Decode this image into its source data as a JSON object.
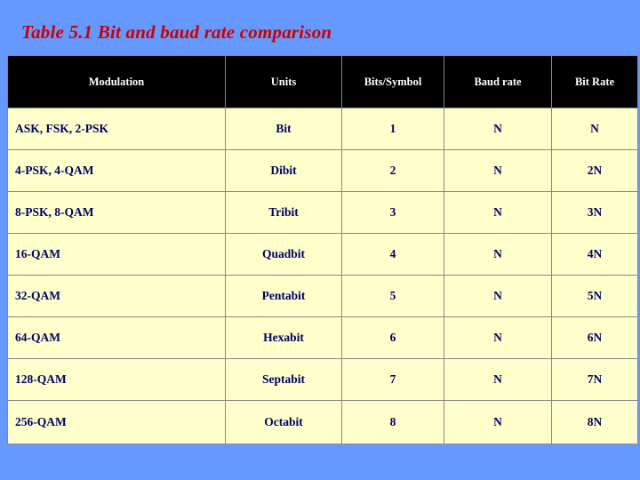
{
  "slide": {
    "title": "Table 5.1  Bit and baud rate comparison",
    "title_color": "#CC0000",
    "background_color": "#6699FF"
  },
  "table": {
    "header_background": "#000000",
    "header_text_color": "#FFFFFF",
    "cell_background": "#FFFFCC",
    "cell_text_color": "#000066",
    "columns": [
      "Modulation",
      "Units",
      "Bits/Symbol",
      "Baud rate",
      "Bit Rate"
    ],
    "rows": [
      {
        "modulation": "ASK, FSK, 2-PSK",
        "units": "Bit",
        "bits_per_symbol": "1",
        "baud_rate": "N",
        "bit_rate": "N"
      },
      {
        "modulation": "4-PSK, 4-QAM",
        "units": "Dibit",
        "bits_per_symbol": "2",
        "baud_rate": "N",
        "bit_rate": "2N"
      },
      {
        "modulation": "8-PSK, 8-QAM",
        "units": "Tribit",
        "bits_per_symbol": "3",
        "baud_rate": "N",
        "bit_rate": "3N"
      },
      {
        "modulation": "16-QAM",
        "units": "Quadbit",
        "bits_per_symbol": "4",
        "baud_rate": "N",
        "bit_rate": "4N"
      },
      {
        "modulation": "32-QAM",
        "units": "Pentabit",
        "bits_per_symbol": "5",
        "baud_rate": "N",
        "bit_rate": "5N"
      },
      {
        "modulation": "64-QAM",
        "units": "Hexabit",
        "bits_per_symbol": "6",
        "baud_rate": "N",
        "bit_rate": "6N"
      },
      {
        "modulation": "128-QAM",
        "units": "Septabit",
        "bits_per_symbol": "7",
        "baud_rate": "N",
        "bit_rate": "7N"
      },
      {
        "modulation": "256-QAM",
        "units": "Octabit",
        "bits_per_symbol": "8",
        "baud_rate": "N",
        "bit_rate": "8N"
      }
    ]
  }
}
